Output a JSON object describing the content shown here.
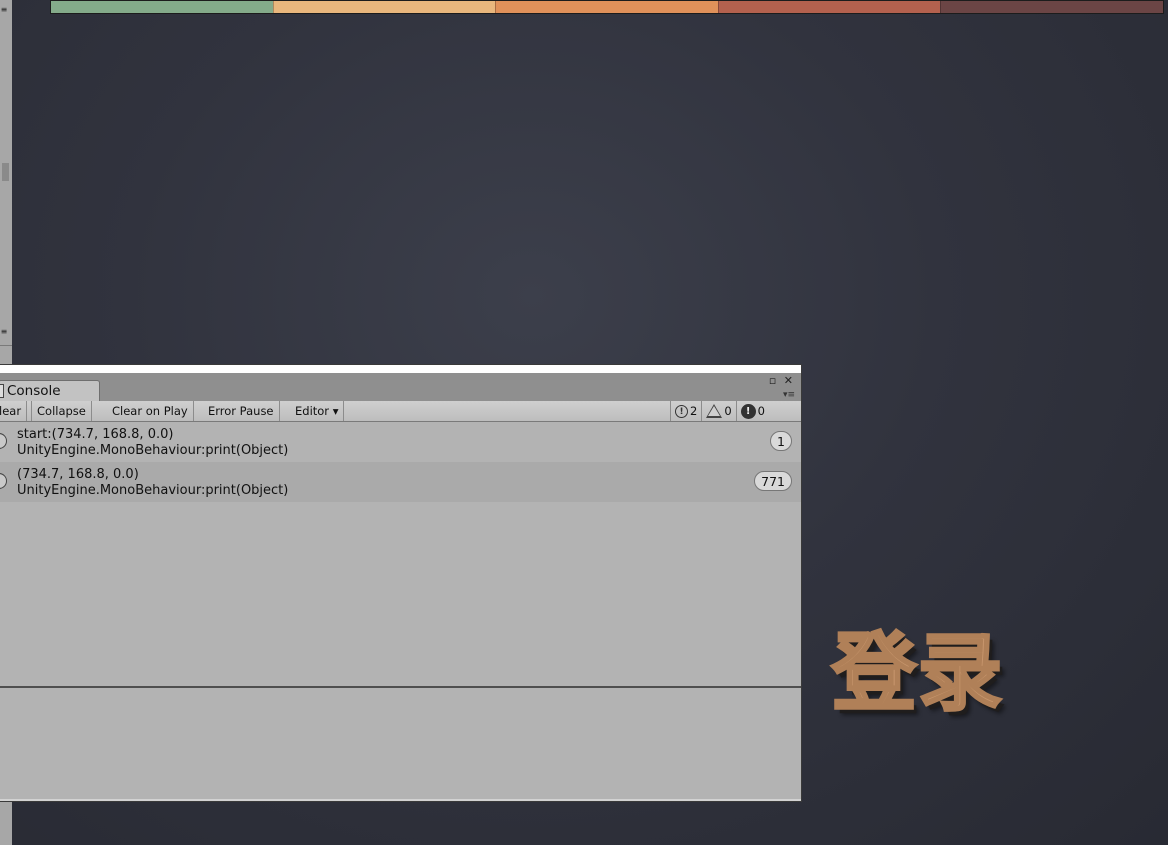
{
  "color_bar": {
    "segments": [
      "#84ab8a",
      "#e9b77d",
      "#e0915a",
      "#b4614e",
      "#6b4545"
    ]
  },
  "console": {
    "tab_label": "Console",
    "window_controls": {
      "maximize": "▫",
      "close": "✕",
      "menu": "▾≡"
    },
    "toolbar": {
      "clear_label": "lear",
      "collapse_label": "Collapse",
      "clear_on_play_label": "Clear on Play",
      "error_pause_label": "Error Pause",
      "editor_label": "Editor ▾",
      "info_count": "2",
      "warning_count": "0",
      "error_count": "0"
    },
    "logs": [
      {
        "line1": "start:(734.7, 168.8, 0.0)",
        "line2": "UnityEngine.MonoBehaviour:print(Object)",
        "count": "1"
      },
      {
        "line1": "(734.7, 168.8, 0.0)",
        "line2": "UnityEngine.MonoBehaviour:print(Object)",
        "count": "771"
      }
    ]
  },
  "game": {
    "login_text": "登录"
  }
}
